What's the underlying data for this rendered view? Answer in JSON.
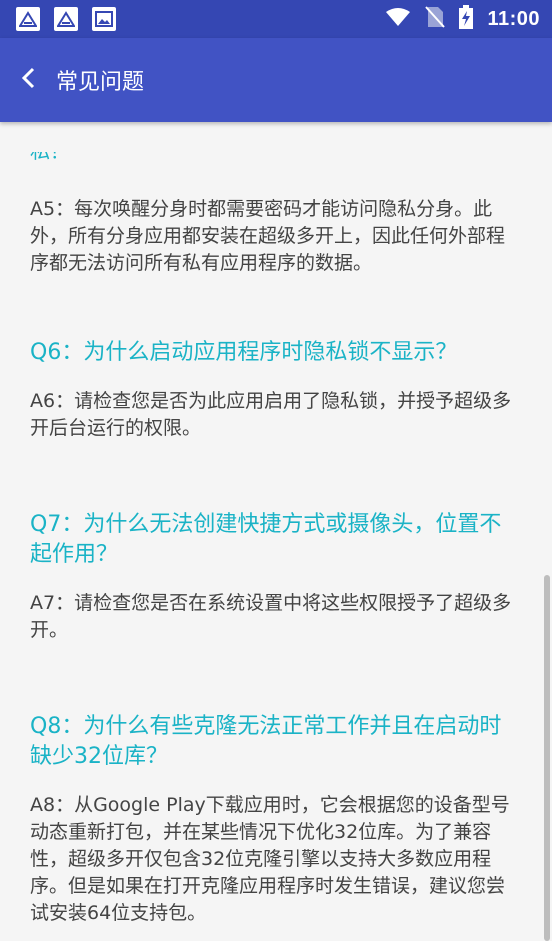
{
  "status_bar": {
    "time": "11:00"
  },
  "app_bar": {
    "title": "常见问题"
  },
  "faq": {
    "partial_prev_tail": "私？",
    "a5": "A5：每次唤醒分身时都需要密码才能访问隐私分身。此外，所有分身应用都安装在超级多开上，因此任何外部程序都无法访问所有私有应用程序的数据。",
    "q6": "Q6：为什么启动应用程序时隐私锁不显示？",
    "a6": "A6：请检查您是否为此应用启用了隐私锁，并授予超级多开后台运行的权限。",
    "q7": "Q7：为什么无法创建快捷方式或摄像头，位置不起作用？",
    "a7": "A7：请检查您是否在系统设置中将这些权限授予了超级多开。",
    "q8": "Q8：为什么有些克隆无法正常工作并且在启动时缺少32位库？",
    "a8": "A8：从Google Play下载应用时，它会根据您的设备型号动态重新打包，并在某些情况下优化32位库。为了兼容性，超级多开仅包含32位克隆引擎以支持大多数应用程序。但是如果在打开克隆应用程序时发生错误，建议您尝试安装64位支持包。"
  }
}
